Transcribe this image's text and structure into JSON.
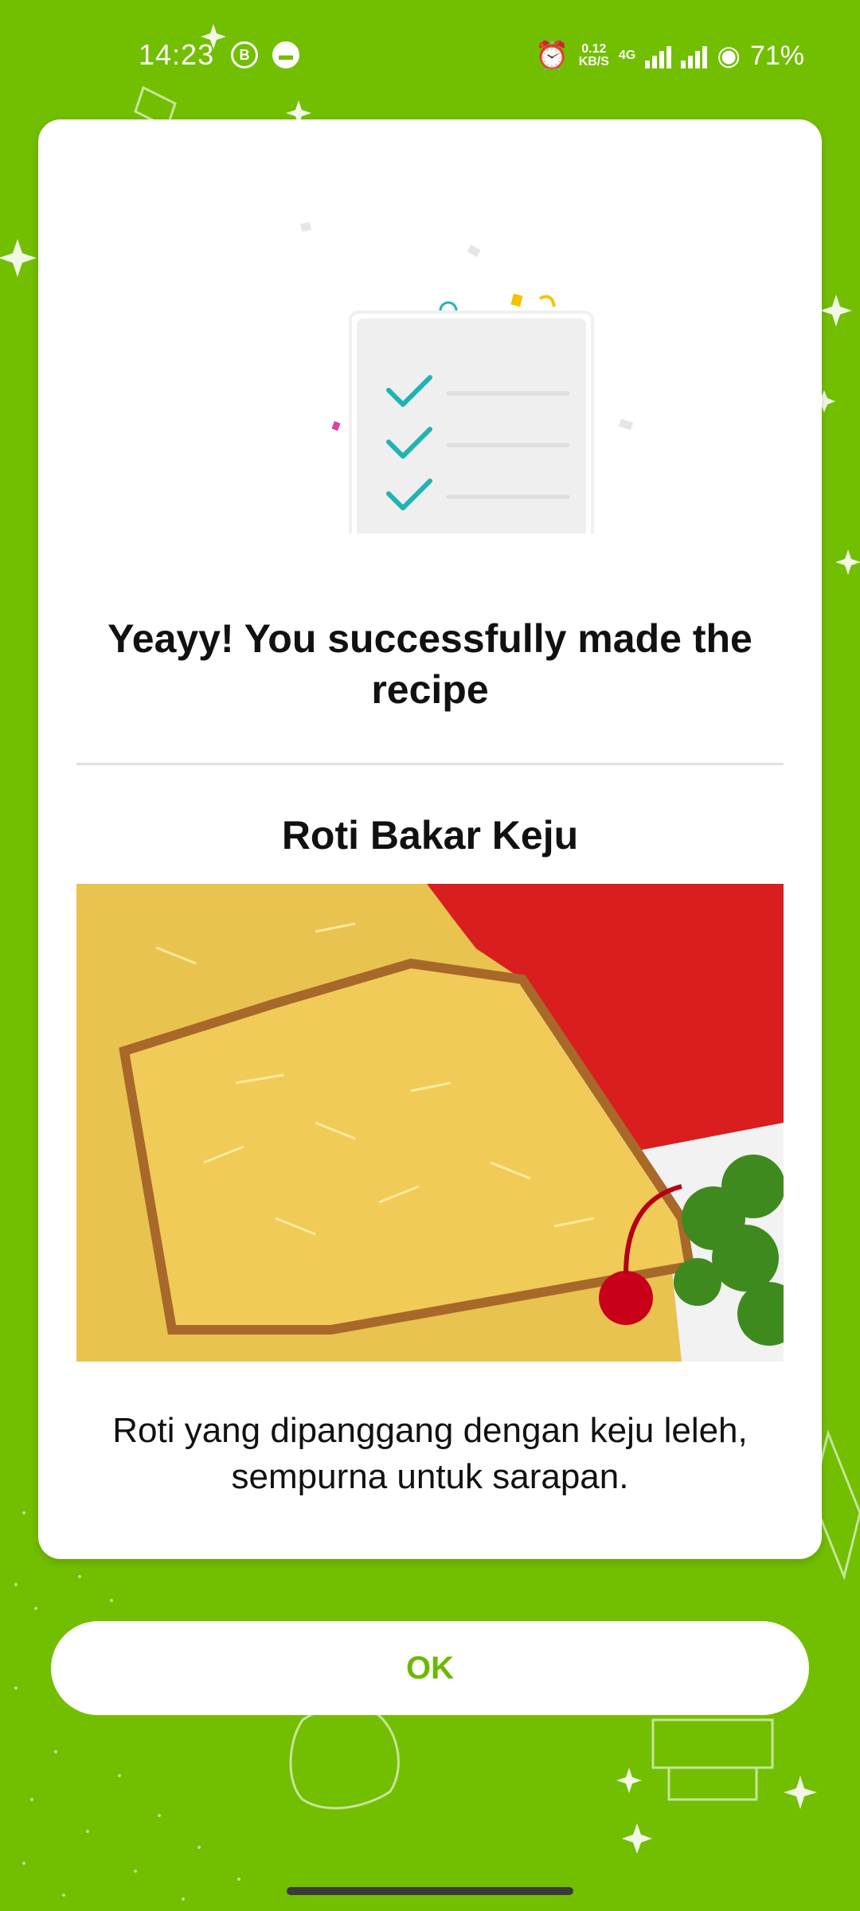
{
  "status_bar": {
    "time": "14:23",
    "net_speed_value": "0.12",
    "net_speed_unit": "KB/S",
    "net_type": "4G",
    "battery": "71%"
  },
  "dialog": {
    "title": "Yeayy! You successfully made the recipe",
    "recipe_name": "Roti Bakar Keju",
    "description": "Roti yang dipanggang dengan keju leleh, sempurna untuk sarapan."
  },
  "actions": {
    "ok_label": "OK"
  },
  "colors": {
    "background": "#72be00",
    "button_text": "#6cb800",
    "check": "#1fb3b3"
  }
}
